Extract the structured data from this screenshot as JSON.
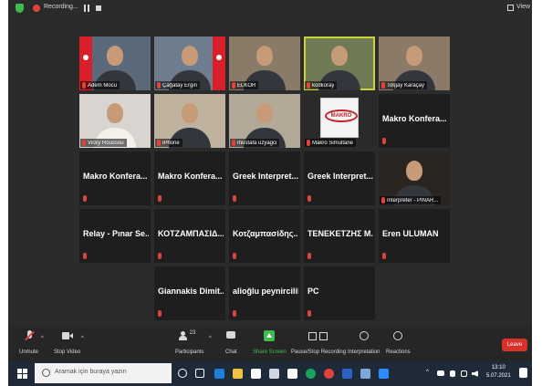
{
  "topbar": {
    "recording_label": "Recording...",
    "view_label": "View"
  },
  "tiles": [
    {
      "name": "Adem Mocu",
      "type": "video",
      "bg": "#5b6a7a"
    },
    {
      "name": "Çağatay Ergin",
      "type": "video",
      "bg": "#6f7e8e"
    },
    {
      "name": "ELKOR",
      "type": "video",
      "bg": "#8a7a68"
    },
    {
      "name": "kodkoray",
      "type": "video",
      "bg": "#6d7a54",
      "active": true
    },
    {
      "name": "Tolgay Karaçay",
      "type": "video",
      "bg": "#8c7a69"
    },
    {
      "name": "Vicky Roussou",
      "type": "video",
      "bg": "#d9d4cf"
    },
    {
      "name": "iPhone",
      "type": "video",
      "bg": "#bfb39f"
    },
    {
      "name": "mustafa uzyagci",
      "type": "video",
      "bg": "#b2a999"
    },
    {
      "name": "Makro Simultane",
      "type": "makro",
      "bg": "#2a2a2a",
      "logo": "MAKRO"
    },
    {
      "name": "Makro Konfera...",
      "type": "text"
    },
    {
      "name": "Makro Konfera...",
      "type": "text"
    },
    {
      "name": "Makro Konfera...",
      "type": "text"
    },
    {
      "name": "Greek Interpret...",
      "type": "text"
    },
    {
      "name": "Greek Interpret...",
      "type": "text"
    },
    {
      "name": "Interpreter - PINAR...",
      "type": "video",
      "bg": "#2a2520"
    },
    {
      "name": "Relay - Pınar Se...",
      "type": "text"
    },
    {
      "name": "ΚΟΤΖΑΜΠΑΣΙΔ...",
      "type": "text"
    },
    {
      "name": "Κοτζαμπασίδης...",
      "type": "text"
    },
    {
      "name": "ΤΕΝΕΚΕΤΖΗΣ Μ...",
      "type": "text"
    },
    {
      "name": "Eren ULUMAN",
      "type": "text"
    },
    {
      "name": "Giannakis Dimit...",
      "type": "text"
    },
    {
      "name": "alioğlu peynircilik",
      "type": "text"
    },
    {
      "name": "PC",
      "type": "text"
    }
  ],
  "toolbar": {
    "unmute": "Unmute",
    "stop_video": "Stop Video",
    "participants": "Participants",
    "participants_count": "23",
    "chat": "Chat",
    "share_screen": "Share Screen",
    "pause_stop_recording": "Pause/Stop Recording",
    "interpretation": "Interpretation",
    "reactions": "Reactions",
    "leave": "Leave"
  },
  "taskbar": {
    "search_placeholder": "Aramak için buraya yazın",
    "time": "13:10",
    "date": "5.07.2021"
  },
  "colors": {
    "accent_green": "#3dbd4e",
    "leave_red": "#d8302a",
    "mic_red": "#e0433a",
    "active_outline": "#c9d437"
  }
}
